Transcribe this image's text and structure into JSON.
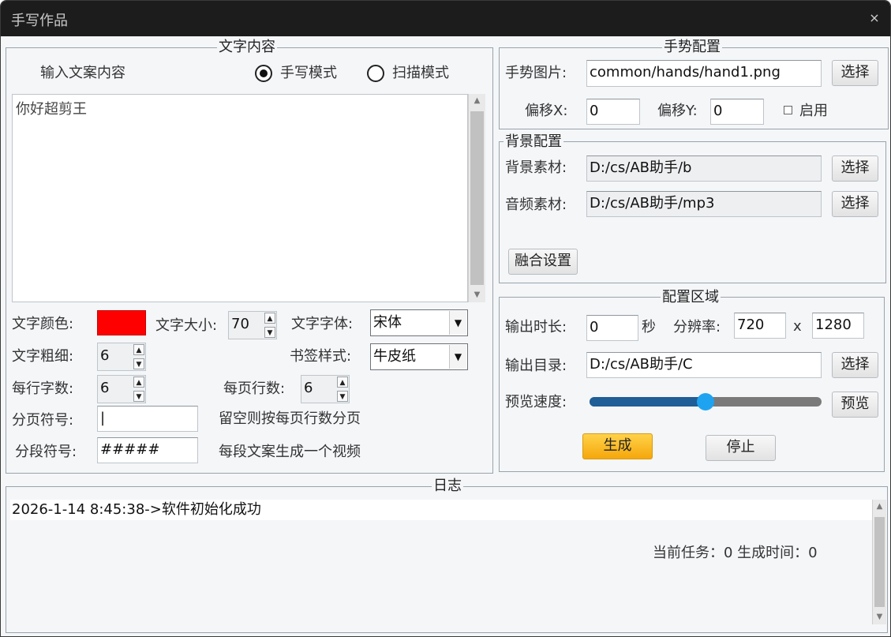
{
  "window": {
    "title": "手写作品",
    "close": "×"
  },
  "text_panel": {
    "title": "文字内容",
    "prompt_label": "输入文案内容",
    "mode_handwrite": "手写模式",
    "mode_scan": "扫描模式",
    "mode_selected": "手写模式",
    "content": "你好超剪王",
    "color_label": "文字颜色:",
    "color_value": "#ff0000",
    "size_label": "文字大小:",
    "size_value": "70",
    "font_label": "文字字体:",
    "font_value": "宋体",
    "weight_label": "文字粗细:",
    "weight_value": "6",
    "bookmark_label": "书签样式:",
    "bookmark_value": "牛皮纸",
    "chars_per_line_label": "每行字数:",
    "chars_per_line_value": "6",
    "lines_per_page_label": "每页行数:",
    "lines_per_page_value": "6",
    "page_sep_label": "分页符号:",
    "page_sep_value": "|",
    "page_sep_hint": "留空则按每页行数分页",
    "para_sep_label": "分段符号:",
    "para_sep_value": "#####",
    "para_sep_hint": "每段文案生成一个视频"
  },
  "gesture_panel": {
    "title": "手势配置",
    "image_label": "手势图片:",
    "image_value": "common/hands/hand1.png",
    "select": "选择",
    "offset_x_label": "偏移X:",
    "offset_x_value": "0",
    "offset_y_label": "偏移Y:",
    "offset_y_value": "0",
    "enable_label": "启用",
    "enabled": false
  },
  "background_panel": {
    "title": "背景配置",
    "bg_label": "背景素材:",
    "bg_value": "D:/cs/AB助手/b",
    "audio_label": "音频素材:",
    "audio_value": "D:/cs/AB助手/mp3",
    "select": "选择",
    "blend_button": "融合设置"
  },
  "config_panel": {
    "title": "配置区域",
    "duration_label": "输出时长:",
    "duration_value": "0",
    "duration_unit": "秒",
    "resolution_label": "分辨率:",
    "width_value": "720",
    "times": "x",
    "height_value": "1280",
    "output_dir_label": "输出目录:",
    "output_dir_value": "D:/cs/AB助手/C",
    "select": "选择",
    "preview_speed_label": "预览速度:",
    "preview_speed_fraction": 0.5,
    "preview_button": "预览",
    "generate_button": "生成",
    "stop_button": "停止"
  },
  "log_panel": {
    "title": "日志",
    "entries": [
      "2026-1-14 8:45:38->软件初始化成功"
    ],
    "status": "当前任务：0 生成时间：0"
  },
  "colors": {
    "accent": "#1f5e96",
    "knob": "#1ea3f0",
    "generate": "#f5a70a"
  }
}
